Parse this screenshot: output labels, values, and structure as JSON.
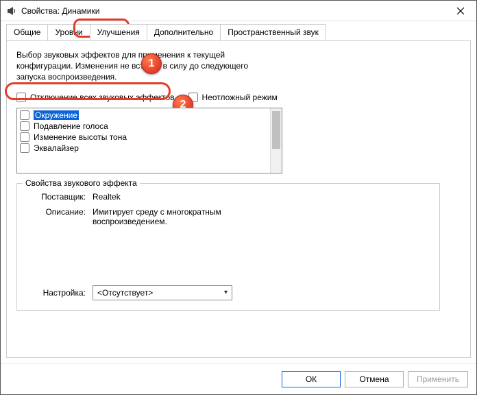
{
  "titlebar": {
    "title": "Свойства: Динамики"
  },
  "tabs": {
    "t0": "Общие",
    "t1": "Уровни",
    "t2": "Улучшения",
    "t3": "Дополнительно",
    "t4": "Пространственный звук"
  },
  "desc": "Выбор звуковых эффектов для применения к текущей конфигурации. Изменения не вступят в силу до следующего запуска воспроизведения.",
  "checks": {
    "disable_all": "Отключение всех звуковых эффектов",
    "immediate": "Неотложный режим"
  },
  "effects": {
    "e0": "Окружение",
    "e1": "Подавление голоса",
    "e2": "Изменение высоты тона",
    "e3": "Эквалайзер"
  },
  "group": {
    "legend": "Свойства звукового эффекта",
    "provider_lbl": "Поставщик:",
    "provider_val": "Realtek",
    "desc_lbl": "Описание:",
    "desc_val": "Имитирует среду с многократным воспроизведением.",
    "setting_lbl": "Настройка:",
    "setting_val": "<Отсутствует>"
  },
  "buttons": {
    "ok": "ОК",
    "cancel": "Отмена",
    "apply": "Применить"
  },
  "annotations": {
    "b1": "1",
    "b2": "2"
  }
}
